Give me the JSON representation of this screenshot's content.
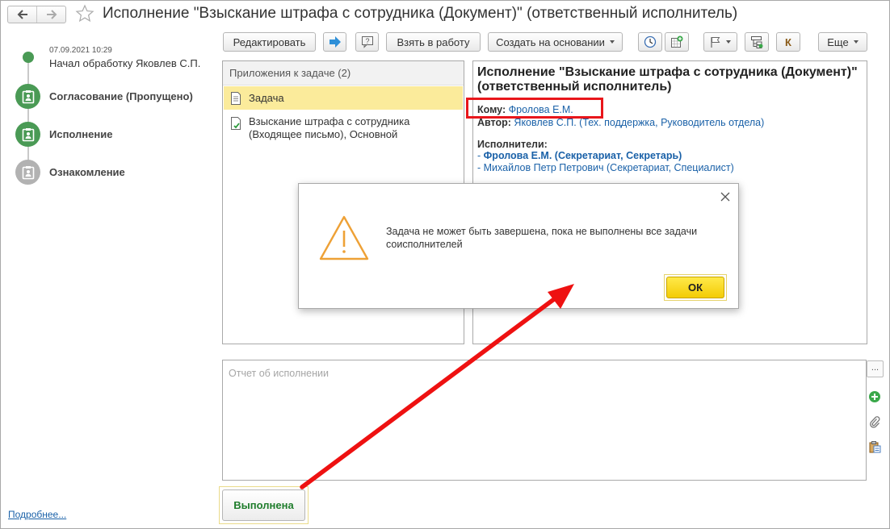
{
  "window": {
    "title": "Исполнение \"Взыскание штрафа с сотрудника (Документ)\" (ответственный исполнитель)"
  },
  "timeline": {
    "start_date": "07.09.2021 10:29",
    "start_label": "Начал обработку Яковлев С.П.",
    "steps": [
      {
        "label": "Согласование (Пропущено)",
        "state": "done"
      },
      {
        "label": "Исполнение",
        "state": "current"
      },
      {
        "label": "Ознакомление",
        "state": "pending"
      }
    ],
    "more_link": "Подробнее..."
  },
  "toolbar": {
    "edit": "Редактировать",
    "take_to_work": "Взять в работу",
    "create_based_on": "Создать на основании",
    "k_label": "К",
    "more": "Еще"
  },
  "attachments": {
    "header": "Приложения к задаче (2)",
    "items": [
      {
        "line1": "Задача",
        "line2": ""
      },
      {
        "line1": "Взыскание штрафа с сотрудника",
        "line2": "(Входящее письмо), Основной"
      }
    ]
  },
  "details": {
    "title": "Исполнение \"Взыскание штрафа с сотрудника (Документ)\" (ответственный исполнитель)",
    "to_label": "Кому:",
    "to_value": "Фролова Е.М.",
    "author_label": "Автор:",
    "author_value": "Яковлев С.П. (Тех. поддержка, Руководитель отдела)",
    "executors_label": "Исполнители:",
    "executors": [
      {
        "prefix": "- ",
        "name": "Фролова Е.М. (Секретариат, Секретарь)"
      },
      {
        "prefix": "- ",
        "name": "Михайлов Петр Петрович (Секретариат, Специалист)"
      }
    ]
  },
  "report": {
    "placeholder": "Отчет об исполнении",
    "dots": "..."
  },
  "done_button": "Выполнена",
  "dialog": {
    "message": "Задача не может быть завершена, пока не выполнены все задачи соисполнителей",
    "ok": "ОК"
  },
  "colors": {
    "green": "#4a9a55",
    "link": "#1a61a8",
    "highlight_red": "#e8161b",
    "ok_yellow": "#f3cc05",
    "selected_row": "#fbeb9b"
  }
}
